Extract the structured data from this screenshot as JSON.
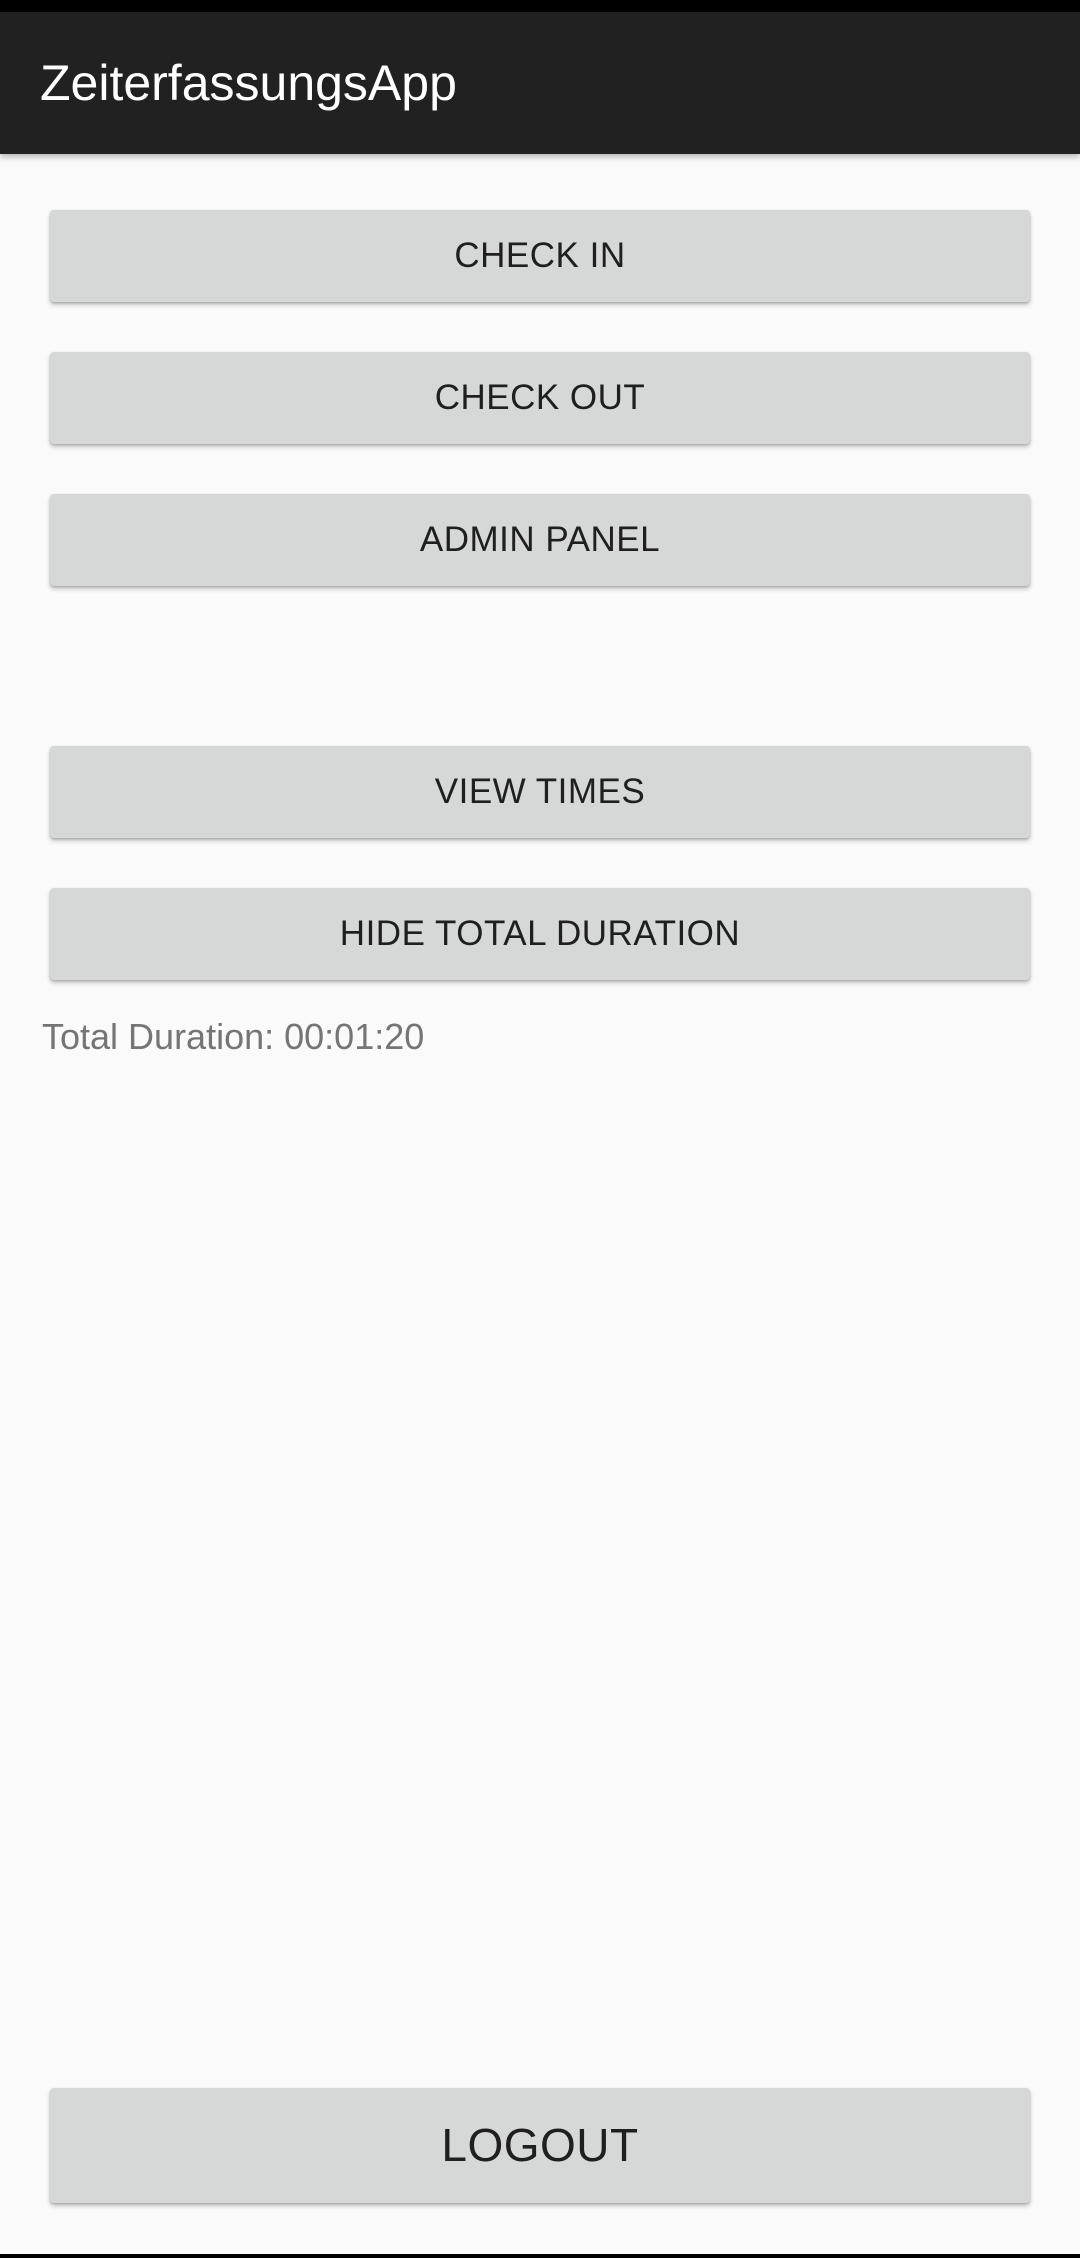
{
  "app_bar": {
    "title": "ZeiterfassungsApp"
  },
  "buttons": {
    "check_in": "CHECK IN",
    "check_out": "CHECK OUT",
    "admin_panel": "ADMIN PANEL",
    "view_times": "VIEW TIMES",
    "hide_total_duration": "HIDE TOTAL DURATION",
    "logout": "LOGOUT"
  },
  "summary": {
    "total_duration_text": "Total Duration: 00:01:20"
  },
  "colors": {
    "app_bar_background": "#212121",
    "page_background": "#fafafa",
    "button_background": "#d6d7d7",
    "button_text": "#1f1f1f",
    "secondary_text": "#757575"
  }
}
